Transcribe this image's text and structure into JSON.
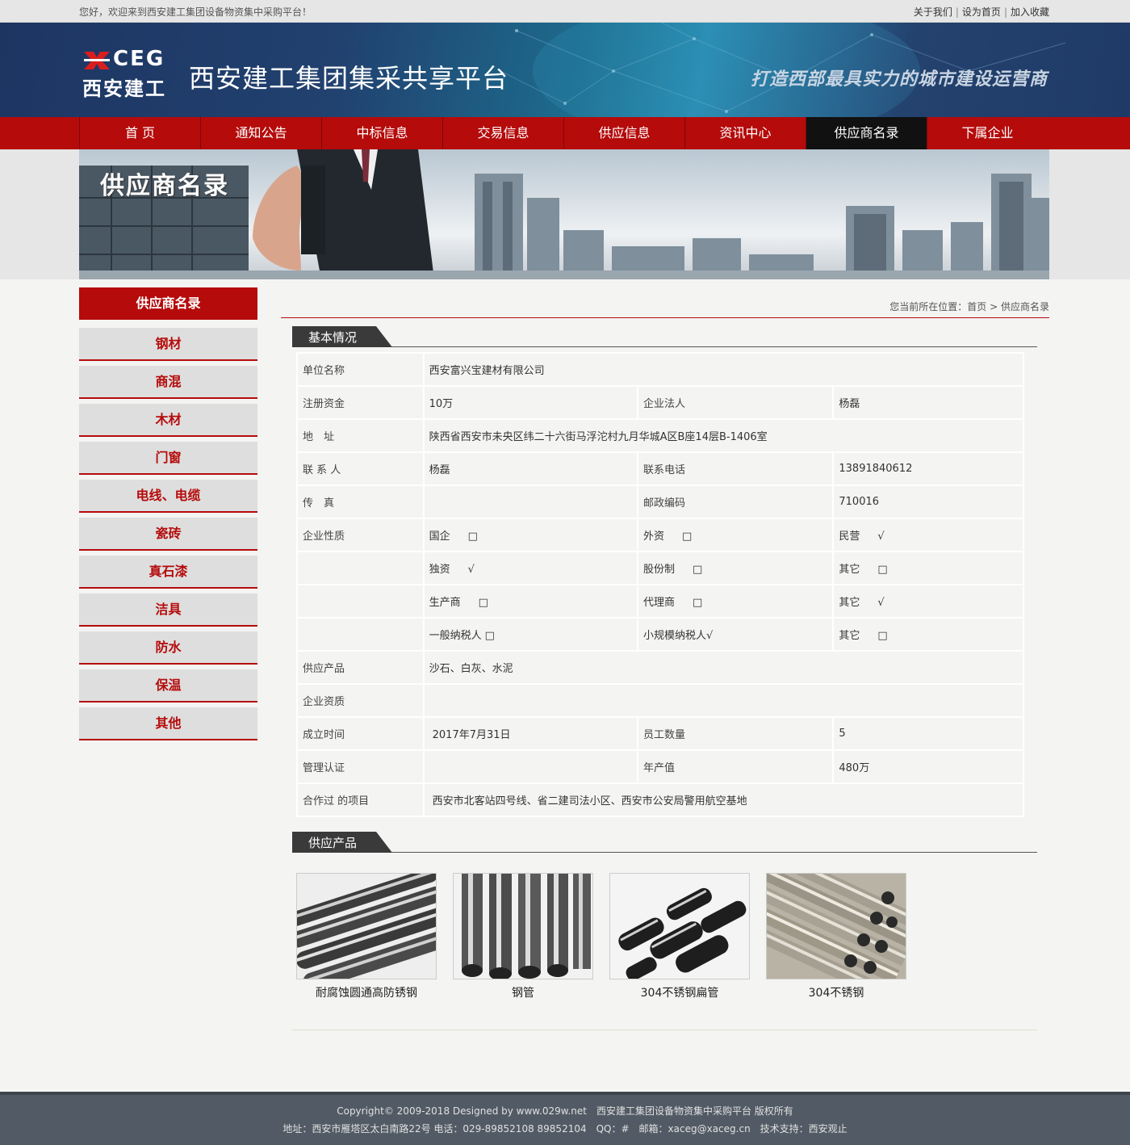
{
  "topbar": {
    "welcome": "您好，欢迎来到西安建工集团设备物资集中采购平台！",
    "links": [
      "关于我们",
      "设为首页",
      "加入收藏"
    ]
  },
  "header": {
    "logo_en": "CEG",
    "logo_cn": "西安建工",
    "title": "西安建工集团集采共享平台",
    "slogan": "打造西部最具实力的城市建设运营商"
  },
  "nav": {
    "items": [
      "首 页",
      "通知公告",
      "中标信息",
      "交易信息",
      "供应信息",
      "资讯中心",
      "供应商名录",
      "下属企业"
    ],
    "active_index": 6
  },
  "hero": {
    "title": "供应商名录"
  },
  "sidebar": {
    "title": "供应商名录",
    "items": [
      "钢材",
      "商混",
      "木材",
      "门窗",
      "电线、电缆",
      "瓷砖",
      "真石漆",
      "洁具",
      "防水",
      "保温",
      "其他"
    ]
  },
  "breadcrumb": {
    "prefix": "您当前所在位置：",
    "home": "首页",
    "sep": " > ",
    "current": "供应商名录"
  },
  "basic": {
    "section_title": "基本情况",
    "unit_name_label": "单位名称",
    "unit_name": "西安富兴宝建材有限公司",
    "capital_label": "注册资金",
    "capital": "10万",
    "legal_label": "企业法人",
    "legal": "杨磊",
    "address_label": "地　址",
    "address": "陕西省西安市未央区纬二十六街马浮沱村九月华城A区B座14层B-1406室",
    "contact_label": "联 系 人",
    "contact": "杨磊",
    "phone_label": "联系电话",
    "phone": "13891840612",
    "fax_label": "传　真",
    "fax": "",
    "zip_label": "邮政编码",
    "zip": "710016",
    "nature_label": "企业性质",
    "nature_rows": [
      [
        {
          "name": "国企",
          "mark": "□"
        },
        {
          "name": "外资",
          "mark": "□"
        },
        {
          "name": "民营",
          "mark": "√"
        }
      ],
      [
        {
          "name": "独资",
          "mark": "√"
        },
        {
          "name": "股份制",
          "mark": "□"
        },
        {
          "name": "其它",
          "mark": "□"
        }
      ],
      [
        {
          "name": "生产商",
          "mark": "□"
        },
        {
          "name": "代理商",
          "mark": "□"
        },
        {
          "name": "其它",
          "mark": "√"
        }
      ],
      [
        {
          "name": "一般纳税人",
          "mark": "□"
        },
        {
          "name": "小规模纳税人",
          "mark": "√"
        },
        {
          "name": "其它",
          "mark": "□"
        }
      ]
    ],
    "products_label": "供应产品",
    "products": "沙石、白灰、水泥",
    "qualification_label": "企业资质",
    "qualification": "",
    "founded_label": "成立时间",
    "founded": "2017年7月31日",
    "staff_label": "员工数量",
    "staff": "5",
    "cert_label": "管理认证",
    "cert": "",
    "output_label": "年产值",
    "output": "480万",
    "projects_label": "合作过 的项目",
    "projects": "西安市北客站四号线、省二建司法小区、西安市公安局警用航空基地"
  },
  "supply": {
    "section_title": "供应产品",
    "items": [
      {
        "caption": "耐腐蚀圆通高防锈钢"
      },
      {
        "caption": "钢管"
      },
      {
        "caption": "304不锈钢扁管"
      },
      {
        "caption": "304不锈钢"
      }
    ]
  },
  "footer": {
    "line1": "Copyright© 2009-2018 Designed by www.029w.net　西安建工集团设备物资集中采购平台 版权所有",
    "line2": "地址：西安市雁塔区太白南路22号 电话：029-89852108 89852104　QQ：#　邮箱：xaceg@xaceg.cn　技术支持：西安观止"
  },
  "colors": {
    "brand_red": "#b50b0b",
    "header_blue": "#1e3562",
    "footer": "#525b65"
  }
}
